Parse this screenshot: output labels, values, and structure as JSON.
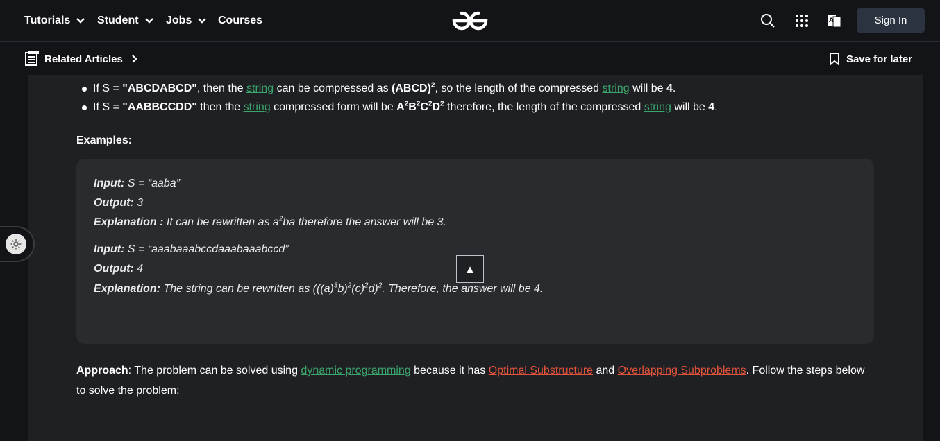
{
  "nav": {
    "items": [
      {
        "label": "Tutorials",
        "dropdown": true
      },
      {
        "label": "Student",
        "dropdown": true
      },
      {
        "label": "Jobs",
        "dropdown": true
      },
      {
        "label": "Courses",
        "dropdown": false
      }
    ],
    "logo_icon": "geeksforgeeks-logo",
    "search_icon": "search-icon",
    "apps_icon": "apps-grid-icon",
    "translate_icon": "translate-icon",
    "signin_label": "Sign In"
  },
  "subbar": {
    "related_label": "Related Articles",
    "save_label": "Save for later"
  },
  "bullets": [
    {
      "p1": "If S = ",
      "b1": "\"ABCDABCD\"",
      "p2": ", then the ",
      "link1": "string",
      "p3": " can be compressed as ",
      "b2": "(ABCD)",
      "sup1": "2",
      "p4": ", so the length of the compressed ",
      "link2": "string",
      "p5": " will be ",
      "b3": "4",
      "p6": "."
    },
    {
      "p1": "If S = ",
      "b1": "\"AABBCCDD\"",
      "p2": " then the ",
      "link1": "string",
      "p3": " compressed form will be ",
      "expr": [
        "A",
        "2",
        "B",
        "2",
        "C",
        "2",
        "D",
        "2"
      ],
      "p4": " therefore, the length of the compressed ",
      "link2": "string",
      "p5": " will be ",
      "b3": "4",
      "p6": "."
    }
  ],
  "examples_heading": "Examples:",
  "examples": [
    {
      "input_label": "Input:",
      "input_value": " S = “aaba”",
      "output_label": "Output:",
      "output_value": " 3",
      "explanation_label": "Explanation :",
      "explanation_a": " It can be rewritten as a",
      "explanation_sup": "2",
      "explanation_b": "ba therefore the answer will be 3."
    },
    {
      "input_label": "Input:",
      "input_value": " S = “aaabaaabccdaaabaaabccd”",
      "output_label": "Output:",
      "output_value": " 4",
      "explanation_label": "Explanation:",
      "explanation_a": " The string can be rewritten as (((a)",
      "sup1": "3",
      "t1": "b)",
      "sup2": "2",
      "t2": "(c)",
      "sup3": "2",
      "t3": "d)",
      "sup4": "2",
      "explanation_b": ". Therefore, the answer will be 4."
    }
  ],
  "scroll_top_glyph": "▲",
  "approach": {
    "label": "Approach",
    "t1": ": The problem can be solved using ",
    "link1": "dynamic programming",
    "t2": " because it has ",
    "link2": "Optimal Substructure",
    "t3": " and ",
    "link3": "Overlapping Subproblems",
    "t4": ". Follow the steps below to solve the problem:"
  },
  "theme_toggle_icon": "sun-icon",
  "colors": {
    "background": "#131417",
    "article_bg": "#1f2024",
    "example_box_bg": "#2a2b2f",
    "link_green": "#3ba66b",
    "link_red": "#e4533b",
    "signin_bg": "#2b3340"
  }
}
